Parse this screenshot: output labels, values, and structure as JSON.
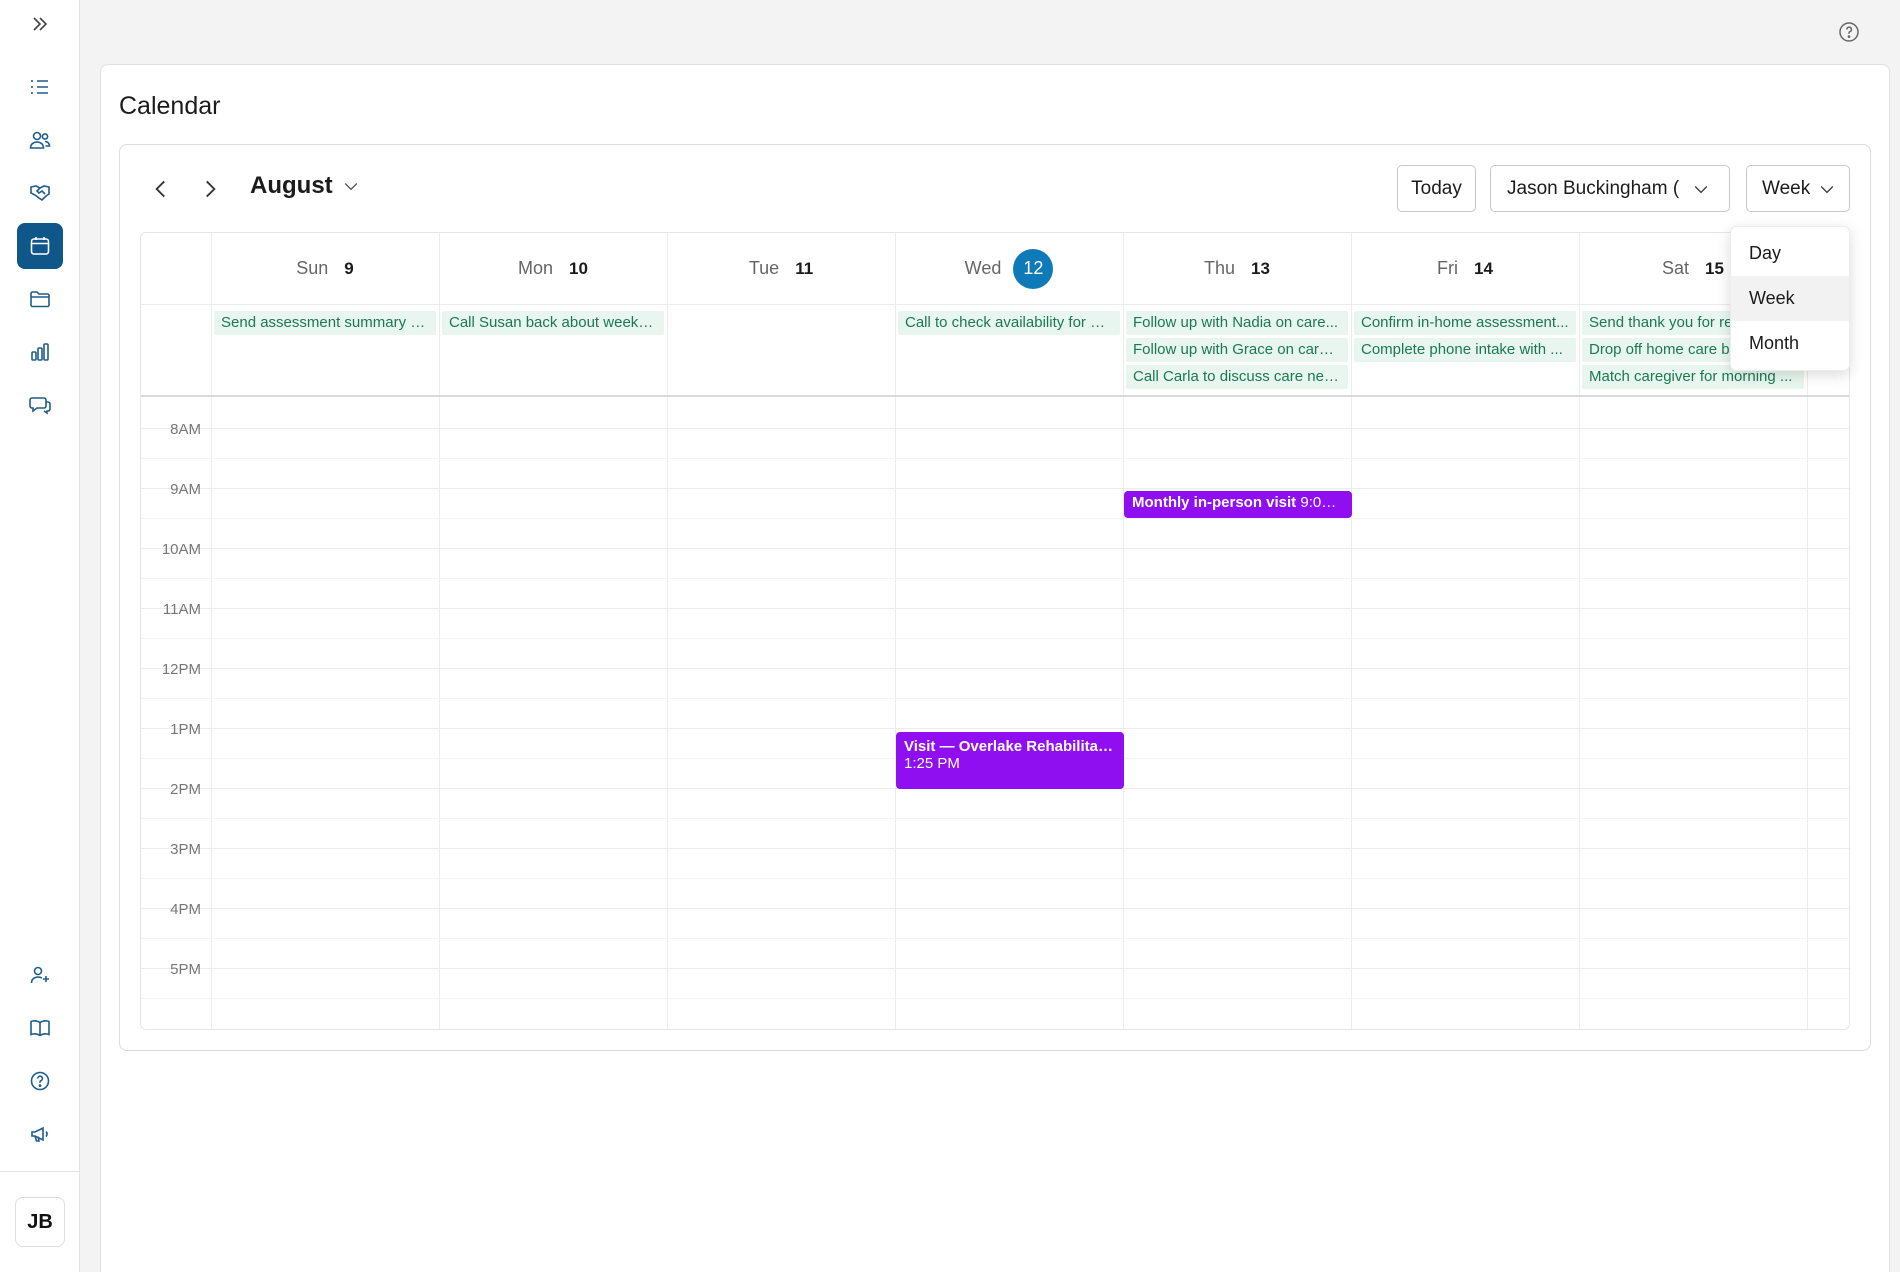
{
  "page": {
    "title": "Calendar"
  },
  "sidebar": {
    "items": [
      {
        "name": "list-icon"
      },
      {
        "name": "people-icon"
      },
      {
        "name": "handshake-icon"
      },
      {
        "name": "calendar-icon",
        "active": true
      },
      {
        "name": "folder-icon"
      },
      {
        "name": "bar-chart-icon"
      },
      {
        "name": "chat-icon"
      }
    ],
    "bottom": [
      {
        "name": "add-person-icon"
      },
      {
        "name": "book-icon"
      },
      {
        "name": "help-icon"
      },
      {
        "name": "megaphone-icon"
      }
    ],
    "avatar_initials": "JB"
  },
  "toolbar": {
    "month": "August",
    "today_label": "Today",
    "user_label": "Jason Buckingham (",
    "view_label": "Week"
  },
  "view_menu": {
    "options": [
      "Day",
      "Week",
      "Month"
    ],
    "selected": "Week"
  },
  "days": [
    {
      "name": "Sun",
      "num": "9"
    },
    {
      "name": "Mon",
      "num": "10"
    },
    {
      "name": "Tue",
      "num": "11"
    },
    {
      "name": "Wed",
      "num": "12",
      "today": true
    },
    {
      "name": "Thu",
      "num": "13"
    },
    {
      "name": "Fri",
      "num": "14"
    },
    {
      "name": "Sat",
      "num": "15"
    }
  ],
  "tasks": {
    "sun": [
      "Send assessment summary to..."
    ],
    "mon": [
      "Call Susan back about weekd..."
    ],
    "wed": [
      "Call to check availability for a ..."
    ],
    "thu": [
      "Follow up with Nadia on care...",
      "Follow up with Grace on care ...",
      "Call Carla to discuss care nee..."
    ],
    "fri": [
      "Confirm in-home assessment...",
      "Complete phone intake with ..."
    ],
    "sat": [
      "Send thank you for re",
      "Drop off home care b",
      "Match caregiver for morning ..."
    ]
  },
  "hours": [
    "8AM",
    "9AM",
    "10AM",
    "11AM",
    "12PM",
    "1PM",
    "2PM",
    "3PM",
    "4PM",
    "5PM"
  ],
  "events": {
    "thu_visit": {
      "title": "Monthly in-person visit",
      "time": "9:00 ..."
    },
    "wed_visit": {
      "title": "Visit — Overlake Rehabilitati...",
      "time": "1:25 PM"
    }
  },
  "colors": {
    "accent": "#0f5689",
    "today_circle": "#0f7ab8",
    "event": "#8f0ff0",
    "task_bg": "#e8f6ef",
    "task_text": "#1a7a52"
  }
}
